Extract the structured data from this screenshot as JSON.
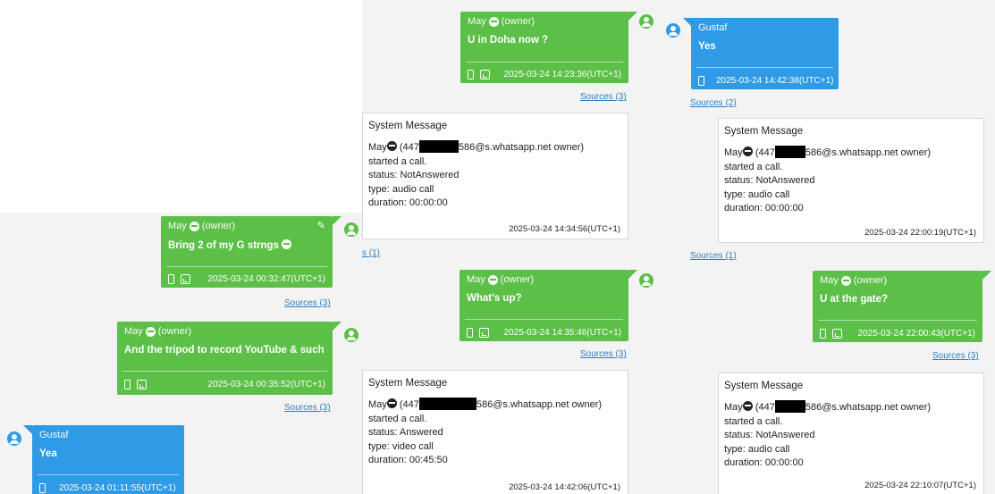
{
  "colors": {
    "owner_bubble": "#5cbf47",
    "contact_bubble": "#2f9ae6",
    "link": "#2f7fc4"
  },
  "icons": [
    "person-avatar-icon",
    "phone-icon",
    "image-icon",
    "pencil-icon",
    "emoji-face-icon"
  ],
  "owner_label": "(owner)",
  "owner_name": "May",
  "contact_name": "Gustaf",
  "panel_left": {
    "msg1": {
      "text": "Bring 2 of my G strngs",
      "timestamp": "2025-03-24 00:32:47(UTC+1)",
      "sources": "Sources (3)"
    },
    "msg2": {
      "text": "And the tripod to record YouTube & such",
      "timestamp": "2025-03-24 00:35:52(UTC+1)",
      "sources": "Sources (3)"
    },
    "msg3": {
      "text": "Yea",
      "timestamp": "2025-03-24 01:11:55(UTC+1)"
    }
  },
  "panel_mid": {
    "msg1": {
      "text": "U in Doha now ?",
      "timestamp": "2025-03-24 14:23:36(UTC+1)",
      "sources": "Sources (3)"
    },
    "sys1": {
      "title": "System Message",
      "line1a": "May",
      "line1b": "(447",
      "line1c": "586@s.whatsapp.net owner)",
      "line2": "started a call.",
      "line3": "status: NotAnswered",
      "line4": "type: audio call",
      "line5": "duration: 00:00:00",
      "timestamp": "2025-03-24 14:34:56(UTC+1)",
      "sources": "s (1)"
    },
    "msg2": {
      "text": "What's up?",
      "timestamp": "2025-03-24 14:35:46(UTC+1)",
      "sources": "Sources (3)"
    },
    "sys2": {
      "title": "System Message",
      "line1a": "May",
      "line1b": "(447",
      "line1c": "586@s.whatsapp.net owner)",
      "line2": "started a call.",
      "line3": "status: Answered",
      "line4": "type: video call",
      "line5": "duration: 00:45:50",
      "timestamp": "2025-03-24 14:42:06(UTC+1)"
    }
  },
  "panel_right": {
    "msg1": {
      "text": "Yes",
      "timestamp": "2025-03-24 14:42:38(UTC+1)",
      "sources": "Sources (2)"
    },
    "sys1": {
      "title": "System Message",
      "line1a": "May",
      "line1b": "(447",
      "line1c": "586@s.whatsapp.net owner)",
      "line2": "started a call.",
      "line3": "status: NotAnswered",
      "line4": "type: audio call",
      "line5": "duration: 00:00:00",
      "timestamp": "2025-03-24 22:00:19(UTC+1)",
      "sources": "Sources (1)"
    },
    "msg2": {
      "text": "U at the gate?",
      "timestamp": "2025-03-24 22:00:43(UTC+1)",
      "sources": "Sources (3)"
    },
    "sys2": {
      "title": "System Message",
      "line1a": "May",
      "line1b": "(447",
      "line1c": "586@s.whatsapp.net owner)",
      "line2": "started a call.",
      "line3": "status: NotAnswered",
      "line4": "type: audio call",
      "line5": "duration: 00:00:00",
      "timestamp": "2025-03-24 22:10:07(UTC+1)"
    }
  }
}
